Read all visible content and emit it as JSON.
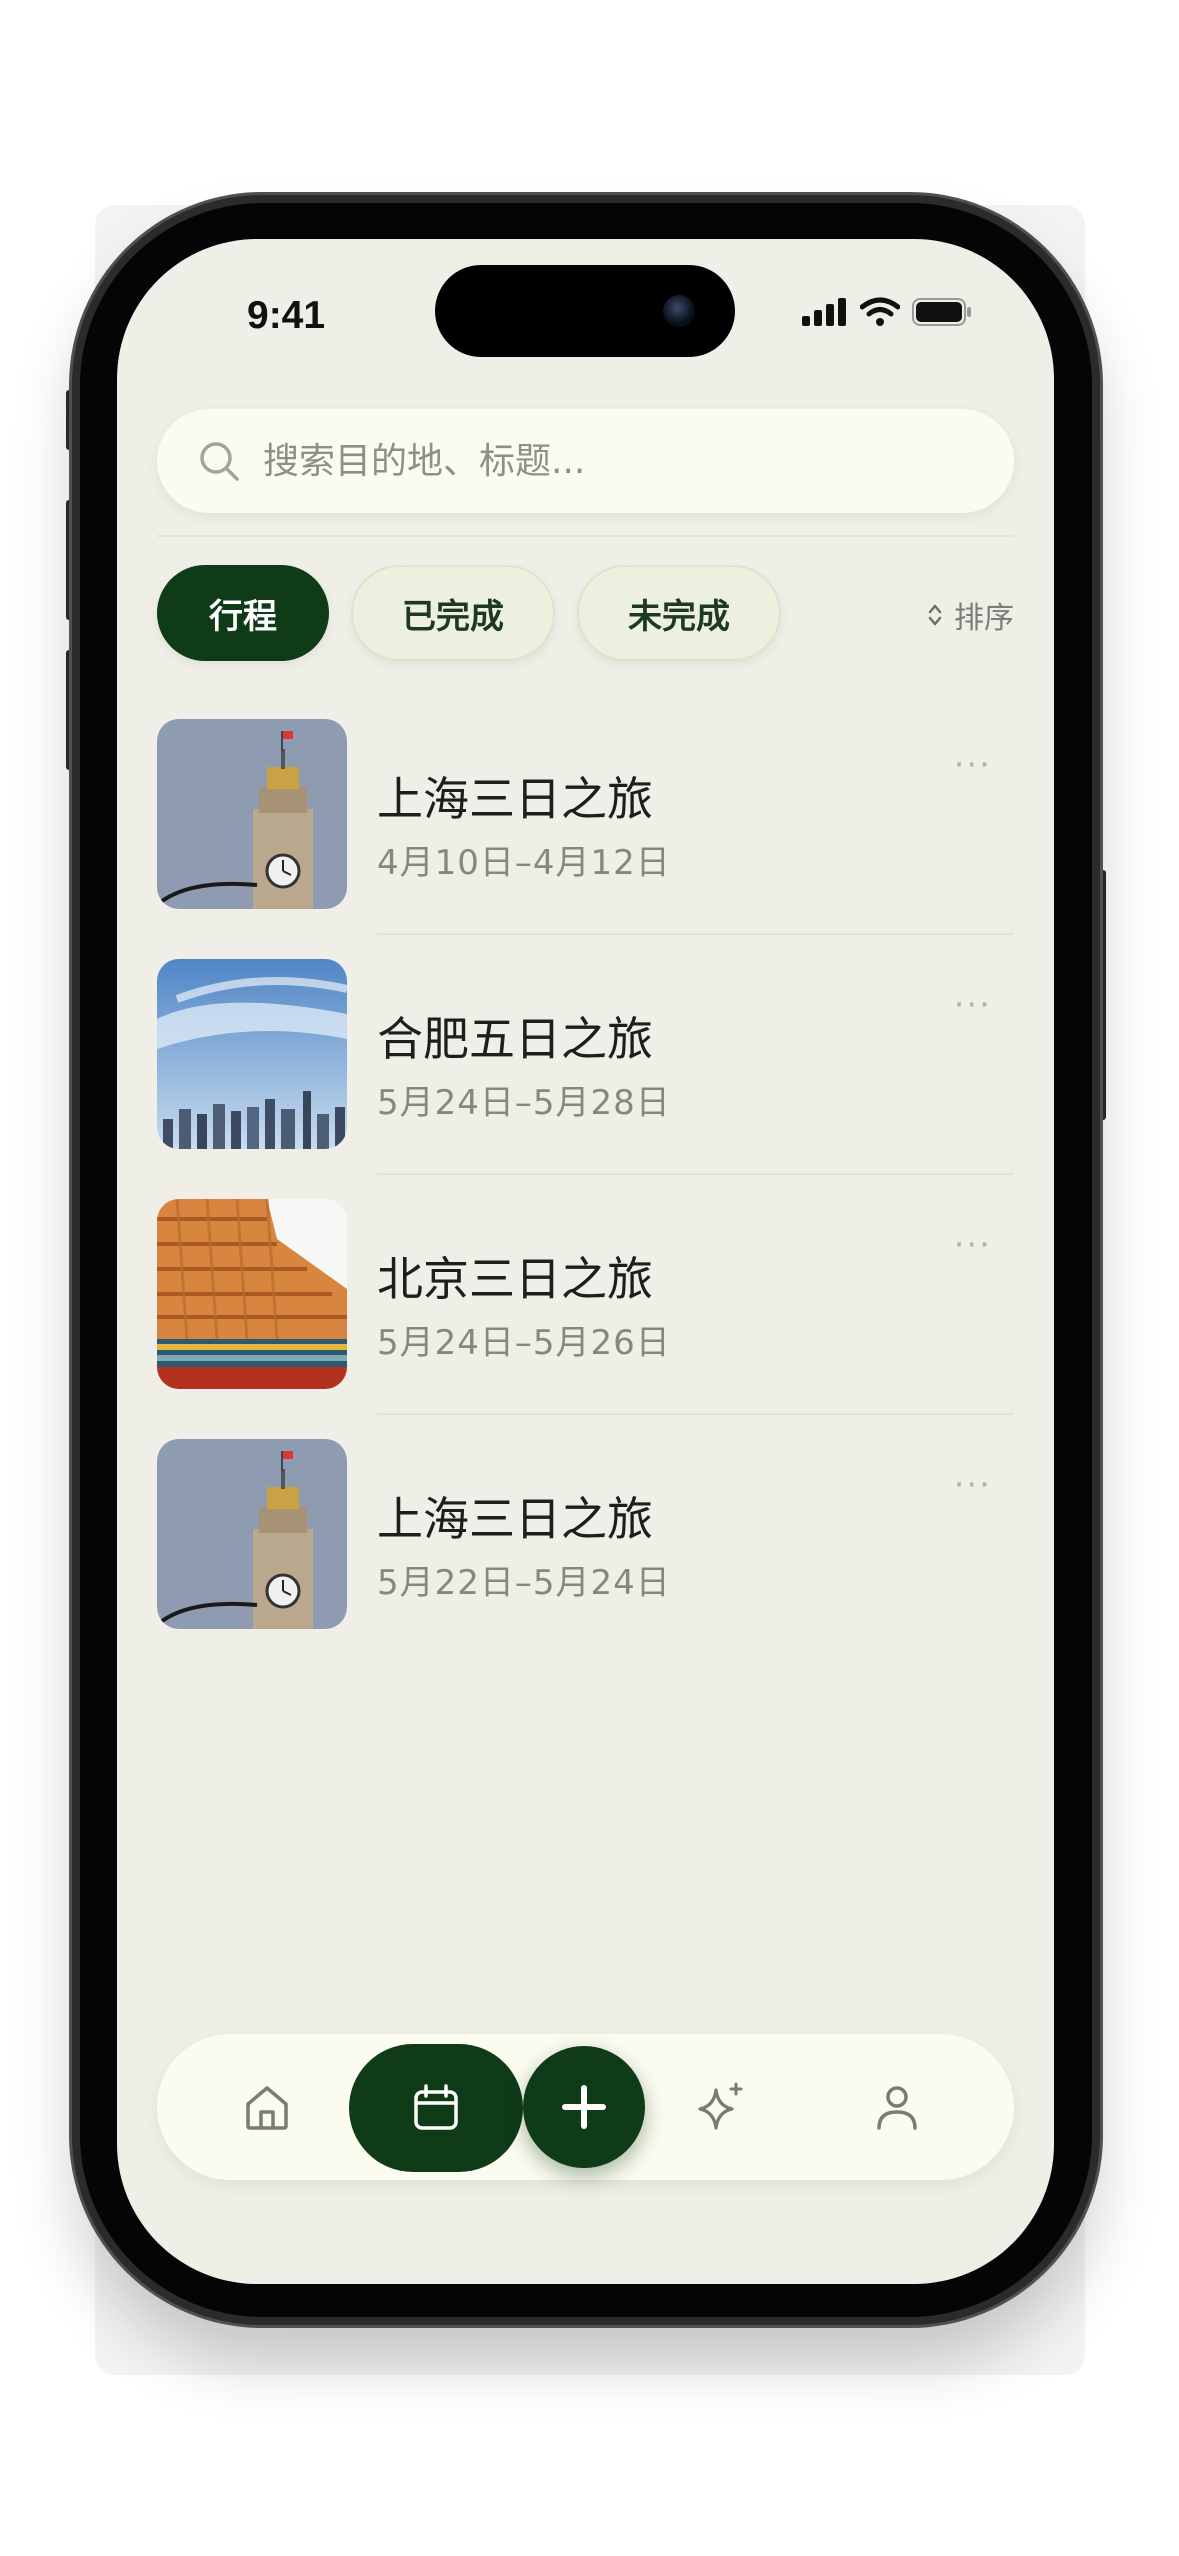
{
  "status_bar": {
    "time": "9:41"
  },
  "search": {
    "placeholder": "搜索目的地、标题..."
  },
  "tabs": [
    {
      "label": "行程",
      "active": true
    },
    {
      "label": "已完成",
      "active": false
    },
    {
      "label": "未完成",
      "active": false
    }
  ],
  "sort": {
    "label": "排序",
    "icon": "sort-updown-icon"
  },
  "trips": [
    {
      "title": "上海三日之旅",
      "dates": "4月10日–4月12日",
      "thumb": "clock-tower",
      "more": "···"
    },
    {
      "title": "合肥五日之旅",
      "dates": "5月24日–5月28日",
      "thumb": "city-skyline",
      "more": "···"
    },
    {
      "title": "北京三日之旅",
      "dates": "5月24日–5月26日",
      "thumb": "palace-roof",
      "more": "···"
    },
    {
      "title": "上海三日之旅",
      "dates": "5月22日–5月24日",
      "thumb": "clock-tower",
      "more": "···"
    }
  ],
  "tabbar": {
    "items": [
      "home-icon",
      "calendar-icon",
      "plus-icon",
      "sparkle-icon",
      "profile-icon"
    ],
    "active": "calendar-icon"
  },
  "colors": {
    "accent": "#0f3b18",
    "background": "#efefe7",
    "chip_idle": "#eef0df",
    "secondary_text": "#86877f"
  }
}
